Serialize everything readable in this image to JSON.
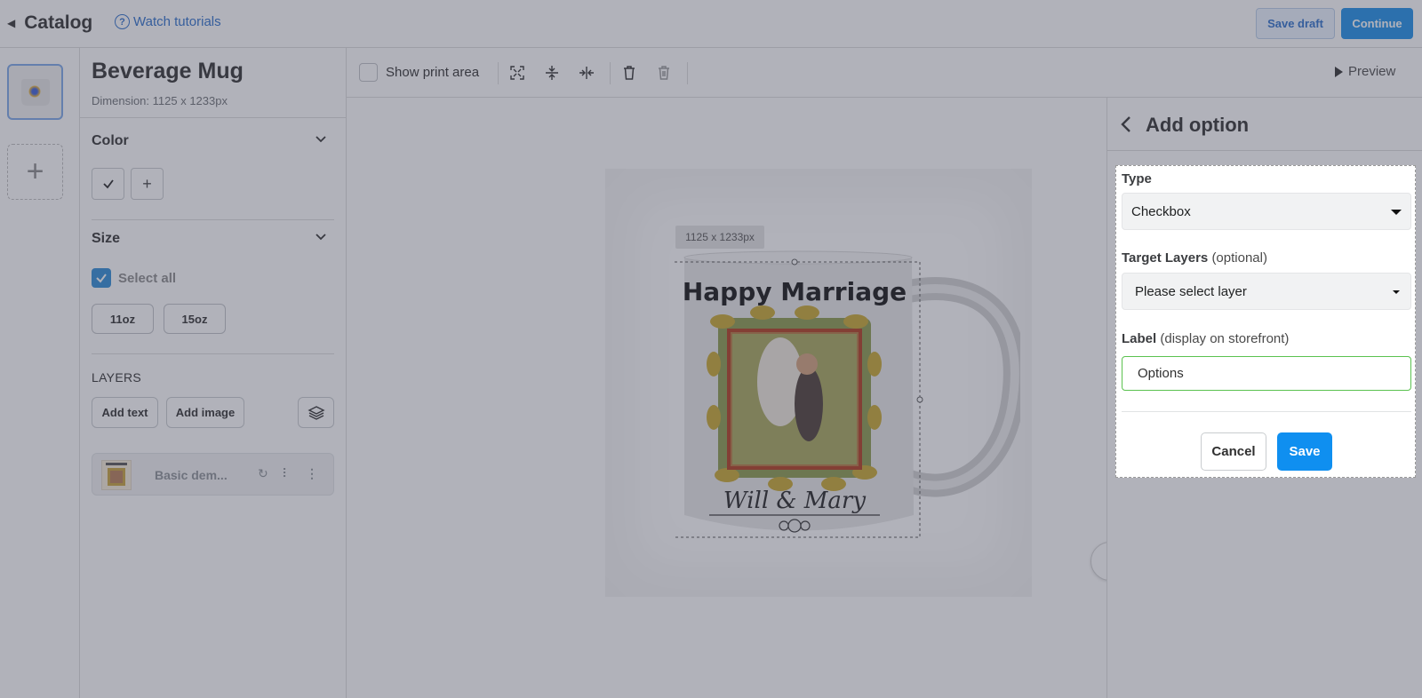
{
  "topbar": {
    "back_icon": "chevron-left-icon",
    "title": "Catalog",
    "tutorial_icon": "question-circle-icon",
    "tutorial_label": "Watch tutorials",
    "save_draft_label": "Save draft",
    "continue_label": "Continue"
  },
  "left_panel": {
    "product_title": "Beverage Mug",
    "dimension": "Dimension: 1125 x 1233px",
    "color": {
      "heading": "Color"
    },
    "size": {
      "heading": "Size",
      "select_all_label": "Select all",
      "select_all_checked": true,
      "options": [
        "11oz",
        "15oz"
      ]
    },
    "layers": {
      "heading": "LAYERS",
      "add_text_label": "Add text",
      "add_image_label": "Add image",
      "items": [
        {
          "name": "Basic dem..."
        }
      ]
    }
  },
  "toolbar": {
    "show_print_area_label": "Show print area",
    "show_print_area_checked": false,
    "preview_label": "Preview"
  },
  "canvas": {
    "dimension_tag": "1125 x 1233px",
    "design": {
      "headline": "Happy Marriage",
      "names": "Will & Mary"
    }
  },
  "right_panel": {
    "title": "Add option",
    "type_label": "Type",
    "type_value": "Checkbox",
    "target_layers_label": "Target Layers",
    "target_layers_optional": "(optional)",
    "target_layers_placeholder": "Please select layer",
    "label_label": "Label",
    "label_hint": "(display on storefront)",
    "label_value": "Options",
    "cancel_label": "Cancel",
    "save_label": "Save"
  },
  "colors": {
    "accent": "#1a8ee8",
    "link": "#2c6ecb",
    "focus_border": "#5bc24f",
    "overlay": "#46485a"
  }
}
